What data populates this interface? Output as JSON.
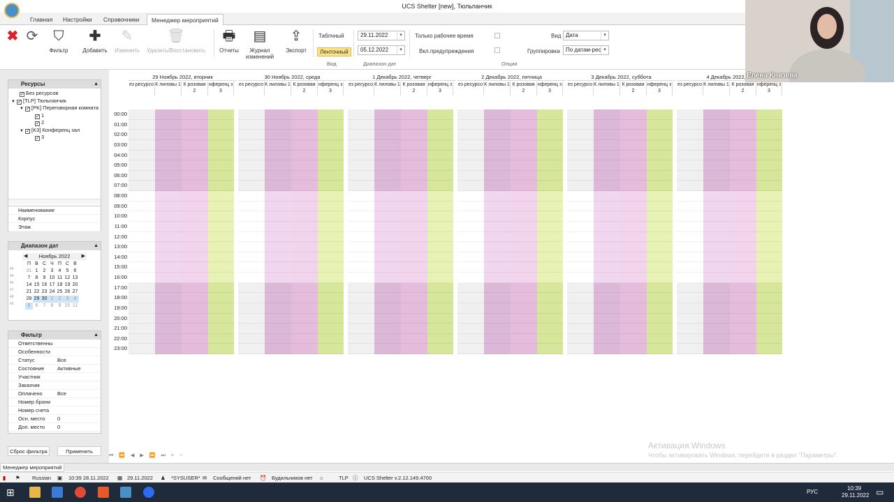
{
  "window": {
    "title": "UCS Shelter [new], Тюльпанчик"
  },
  "tabs": [
    "Главная",
    "Настройки",
    "Справочники",
    "Менеджер мероприятий"
  ],
  "ribbon": {
    "buttons": [
      "Фильтр",
      "Добавить",
      "Изменить",
      "Удалить/Восстановить",
      "Отчеты",
      "Журнал изменений",
      "Экспорт"
    ],
    "view_tabular": "Таблчный",
    "view_tape": "Ленточный",
    "date_from": "29.11.2022",
    "date_to": "05.12.2022",
    "only_work_time": "Только рабочее время",
    "warnings": "Вкл.предупреждения",
    "view_label": "Вид",
    "view_value": "Дата",
    "grouping_label": "Группировка",
    "grouping_value": "По датам-рес",
    "group_view": "Вид",
    "group_range": "Диапазон дат",
    "group_options": "Опции"
  },
  "resources_panel": {
    "title": "Ресурсы",
    "items": [
      "Без ресурсов",
      "[TLP] Тюльпанчик",
      "[PK] Переговорная комнатa",
      "1",
      "2",
      "[K3] Конференц зал",
      "3"
    ],
    "props": [
      "Наименование",
      "Корпус",
      "Этаж"
    ]
  },
  "date_range_panel": {
    "title": "Диапазон дат",
    "month": "Ноябрь 2022",
    "weekdays": [
      "П",
      "В",
      "С",
      "Ч",
      "П",
      "С",
      "В"
    ],
    "weeks": [
      [
        "31",
        "1",
        "2",
        "3",
        "4",
        "5",
        "6"
      ],
      [
        "7",
        "8",
        "9",
        "10",
        "11",
        "12",
        "13"
      ],
      [
        "14",
        "15",
        "16",
        "17",
        "18",
        "19",
        "20"
      ],
      [
        "21",
        "22",
        "23",
        "24",
        "25",
        "26",
        "27"
      ],
      [
        "28",
        "29",
        "30",
        "1",
        "2",
        "3",
        "4"
      ],
      [
        "5",
        "6",
        "7",
        "8",
        "9",
        "10",
        "11"
      ]
    ],
    "week_numbers": [
      "44",
      "45",
      "46",
      "47",
      "48",
      "49"
    ]
  },
  "filter_panel": {
    "title": "Фильтр",
    "rows": [
      {
        "k": "Ответственны",
        "v": ""
      },
      {
        "k": "Особенности",
        "v": ""
      },
      {
        "k": "Статус",
        "v": "Все"
      },
      {
        "k": "Состояние",
        "v": "Активные"
      },
      {
        "k": "Участник",
        "v": ""
      },
      {
        "k": "Заказчик",
        "v": ""
      },
      {
        "k": "Оплачено",
        "v": "Все"
      },
      {
        "k": "Номер брони",
        "v": ""
      },
      {
        "k": "Номер счета",
        "v": ""
      },
      {
        "k": "Осн. место",
        "v": "0"
      },
      {
        "k": "Доп. место",
        "v": "0"
      }
    ],
    "reset": "Сброс фильтра",
    "apply": "Применить"
  },
  "scheduler": {
    "days": [
      "29 Ноябрь 2022, вторник",
      "30 Ноябрь 2022, среда",
      "1 Декабрь 2022, четверг",
      "2 Декабрь 2022, пятница",
      "3 Декабрь 2022, суббота",
      "4 Декабрь 2022, вос"
    ],
    "columns": [
      "ез ресурсо",
      "К лиловы 1",
      "К розовая 2",
      "нференц з 3"
    ],
    "hours": [
      "00:00",
      "01:00",
      "02:00",
      "03:00",
      "04:00",
      "05:00",
      "06:00",
      "07:00",
      "08:00",
      "09:00",
      "10:00",
      "11:00",
      "12:00",
      "13:00",
      "14:00",
      "15:00",
      "16:00",
      "17:00",
      "18:00",
      "19:00",
      "20:00",
      "21:00",
      "22:00",
      "23:00"
    ],
    "colors": {
      "none": "#f0f0f0",
      "lilac": "#dcb8d8",
      "pink": "#e6bcdc",
      "green": "#d6e69a",
      "none_work": "#ffffff",
      "lilac_work": "#f0d6ee",
      "pink_work": "#f2d4ec",
      "green_work": "#e8f2b4"
    }
  },
  "watermark": {
    "title": "Активация Windows",
    "text": "Чтобы активировать Windows, перейдите в раздел \"Параметры\"."
  },
  "bottom_tab": "Менеджер мероприятий",
  "status": {
    "lang": "Russian",
    "time_date": "10:39  28.11.2022",
    "date": "29.11.2022",
    "user": "*SYSUSER*",
    "messages": "Сообщений нет",
    "alarms": "Будильников нет",
    "code": "TLP",
    "version": "UCS Shelter v.2.12.149.4700"
  },
  "taskbar": {
    "lang": "РУС",
    "time": "10:39",
    "date": "29.11.2022"
  },
  "video": {
    "name": "Елена Князева"
  }
}
